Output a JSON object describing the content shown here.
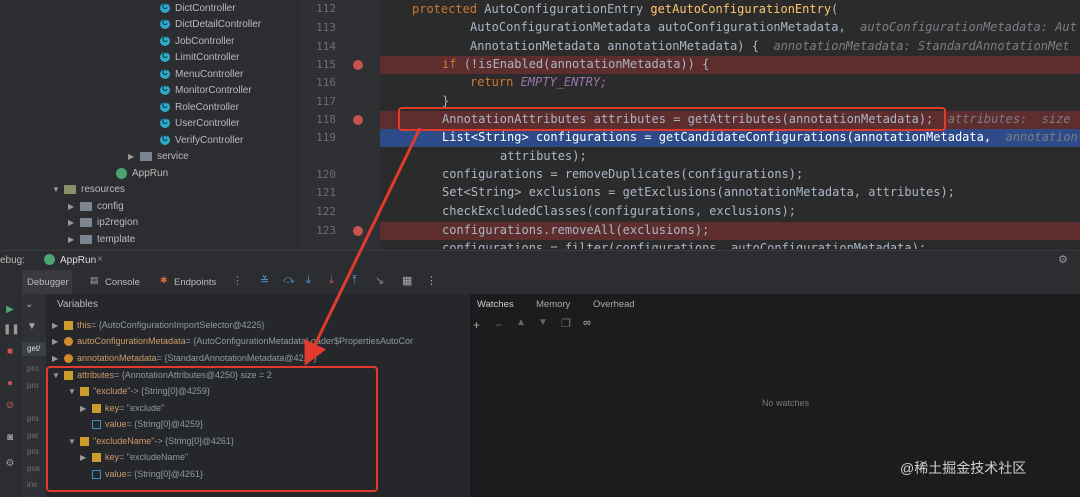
{
  "tree": {
    "controllers": [
      "DictController",
      "DictDetailController",
      "JobController",
      "LimitController",
      "MenuController",
      "MonitorController",
      "RoleController",
      "UserController",
      "VerifyController"
    ],
    "service": "service",
    "app": "AppRun",
    "resources": "resources",
    "res_children": [
      "config",
      "ip2region",
      "template"
    ]
  },
  "editor": {
    "line_numbers": [
      "112",
      "113",
      "114",
      "115",
      "116",
      "117",
      "118",
      "119",
      "",
      "120",
      "121",
      "122",
      "123",
      "124"
    ],
    "lines": {
      "l112_kw": "protected ",
      "l112_rest": "AutoConfigurationEntry ",
      "l112_fn": "getAutoConfigurationEntry",
      "l112_end": "(",
      "l113": "AutoConfigurationMetadata autoConfigurationMetadata,",
      "l113_hint": "autoConfigurationMetadata: Aut",
      "l114": "AnnotationMetadata annotationMetadata) {",
      "l114_hint": "annotationMetadata: StandardAnnotationMet",
      "l115_kw": "if ",
      "l115": "(!isEnabled(annotationMetadata)) {",
      "l116_kw": "return ",
      "l116": "EMPTY_ENTRY;",
      "l117": "}",
      "l118": "AnnotationAttributes attributes = getAttributes(annotationMetadata);",
      "l118_hint": "attributes:  size",
      "l119": "List<String> configurations = getCandidateConfigurations(annotationMetadata,",
      "l119_hint": "annotation",
      "l119b": "attributes);",
      "l120": "configurations = removeDuplicates(configurations);",
      "l121": "Set<String> exclusions = getExclusions(annotationMetadata, attributes);",
      "l122": "checkExcludedClasses(configurations, exclusions);",
      "l123": "configurations.removeAll(exclusions);",
      "l124": "configurations = filter(configurations, autoConfigurationMetadata);"
    }
  },
  "debug": {
    "title": "ebug:",
    "config": "AppRun",
    "tabs": {
      "debugger": "Debugger",
      "console": "Console",
      "endpoints": "Endpoints"
    },
    "variables_label": "Variables",
    "frames_label": "get/",
    "frames": [
      "pro",
      "pro",
      "pro",
      "par",
      "pro",
      "pos",
      "inv"
    ],
    "vars": [
      {
        "name": "this",
        "value": " = {AutoConfigurationImportSelector@4225}"
      },
      {
        "name": "autoConfigurationMetadata",
        "value": " = {AutoConfigurationMetadataLoader$PropertiesAutoCor"
      },
      {
        "name": "annotationMetadata",
        "value": " = {StandardAnnotationMetadata@4227}"
      },
      {
        "name": "attributes",
        "value": " = {AnnotationAttributes@4250}  size = 2"
      },
      {
        "name": "\"exclude\"",
        "value": " -> {String[0]@4259}"
      },
      {
        "name": "key",
        "value": " = \"exclude\""
      },
      {
        "name": "value",
        "value": " = {String[0]@4259}"
      },
      {
        "name": "\"excludeName\"",
        "value": " -> {String[0]@4261}"
      },
      {
        "name": "key",
        "value": " = \"excludeName\""
      },
      {
        "name": "value",
        "value": " = {String[0]@4261}"
      }
    ],
    "watches_tabs": {
      "watches": "Watches",
      "memory": "Memory",
      "overhead": "Overhead"
    },
    "no_watches": "No watches"
  },
  "watermark": "@稀土掘金技术社区",
  "colors": {
    "breakpoint": "#c75450",
    "annotation_red": "#e23b2e"
  }
}
